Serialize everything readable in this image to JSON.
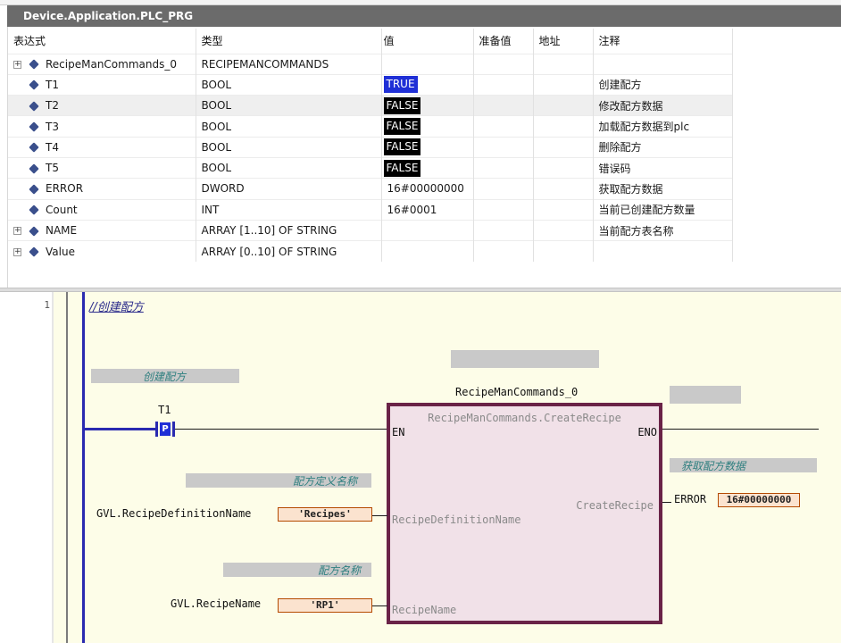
{
  "window": {
    "title": "Device.Application.PLC_PRG"
  },
  "watch": {
    "headers": {
      "expression": "表达式",
      "type": "类型",
      "value": "值",
      "prepared": "准备值",
      "address": "地址",
      "comment": "注释"
    },
    "rows": [
      {
        "name": "RecipeManCommands_0",
        "type": "RECIPEMANCOMMANDS",
        "value": "",
        "value_style": "none",
        "comment": "",
        "expandable": true
      },
      {
        "name": "T1",
        "type": "BOOL",
        "value": "TRUE",
        "value_style": "true",
        "comment": "创建配方",
        "expandable": false
      },
      {
        "name": "T2",
        "type": "BOOL",
        "value": "FALSE",
        "value_style": "false",
        "comment": "修改配方数据",
        "expandable": false
      },
      {
        "name": "T3",
        "type": "BOOL",
        "value": "FALSE",
        "value_style": "false",
        "comment": "加载配方数据到plc",
        "expandable": false
      },
      {
        "name": "T4",
        "type": "BOOL",
        "value": "FALSE",
        "value_style": "false",
        "comment": "删除配方",
        "expandable": false
      },
      {
        "name": "T5",
        "type": "BOOL",
        "value": "FALSE",
        "value_style": "false",
        "comment": "错误码",
        "expandable": false
      },
      {
        "name": "ERROR",
        "type": "DWORD",
        "value": "16#00000000",
        "value_style": "plain",
        "comment": "获取配方数据",
        "expandable": false
      },
      {
        "name": "Count",
        "type": "INT",
        "value": "16#0001",
        "value_style": "plain",
        "comment": "当前已创建配方数量",
        "expandable": false
      },
      {
        "name": "NAME",
        "type": "ARRAY [1..10] OF STRING",
        "value": "",
        "value_style": "none",
        "comment": "当前配方表名称",
        "expandable": true
      },
      {
        "name": "Value",
        "type": "ARRAY [0..10] OF STRING",
        "value": "",
        "value_style": "none",
        "comment": "",
        "expandable": true
      }
    ]
  },
  "editor": {
    "line_number": "1",
    "network_comment": "//创建配方",
    "comment_create": "创建配方",
    "comment_get_data": "获取配方数据",
    "comment_def_name": "配方定义名称",
    "comment_recipe_name": "配方名称",
    "contact_var": "T1",
    "contact_type": "P",
    "fb_instance": "RecipeManCommands_0",
    "fb_type": "RecipeManCommands.CreateRecipe",
    "pin_en": "EN",
    "pin_eno": "ENO",
    "pin_create_recipe": "CreateRecipe",
    "pin_def_name": "RecipeDefinitionName",
    "pin_recipe_name": "RecipeName",
    "out_var": "ERROR",
    "out_value": "16#00000000",
    "in1_var": "GVL.RecipeDefinitionName",
    "in1_value": "'Recipes'",
    "in2_var": "GVL.RecipeName",
    "in2_value": "'RP1'"
  },
  "colors": {
    "true_bg": "#1f2fd6",
    "false_bg": "#000000",
    "fb_border": "#6a2347",
    "fb_fill": "#f1e1e8",
    "editor_bg": "#fdfde8",
    "rail": "#2a2ab0"
  }
}
